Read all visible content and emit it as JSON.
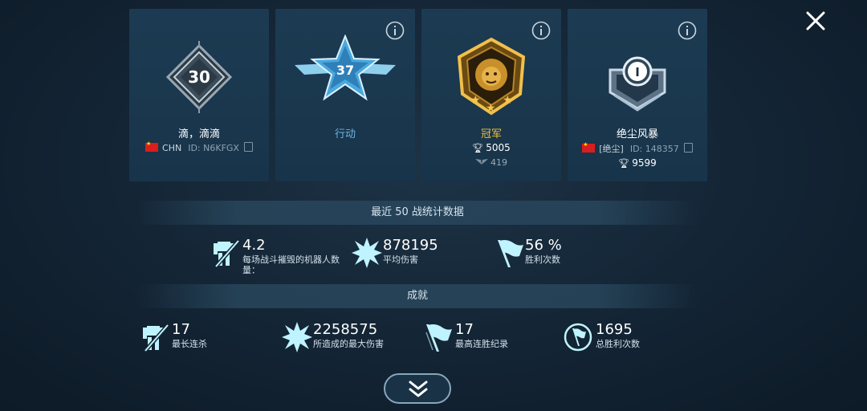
{
  "close_icon": "close-icon",
  "cards": {
    "player": {
      "level": "30",
      "name": "滴，滴滴",
      "country": "CHN",
      "id": "ID: N6KFGX"
    },
    "rank": {
      "level": "37",
      "name": "行动"
    },
    "league": {
      "name": "冠军",
      "trophies": "5005",
      "sub_value": "419"
    },
    "clan": {
      "badge_text": "I",
      "name": "绝尘风暴",
      "tag": "[绝尘]",
      "id": "ID: 148357",
      "trophies": "9599"
    }
  },
  "recent": {
    "title": "最近 50 战统计数据",
    "stats": [
      {
        "value": "4.2",
        "label_line1": "每场战斗摧毁的机器人数",
        "label_line2": "量："
      },
      {
        "value": "878195",
        "label_line1": "平均伤害",
        "label_line2": ""
      },
      {
        "value": "56 %",
        "label_line1": "胜利次数",
        "label_line2": ""
      }
    ]
  },
  "achievements": {
    "title": "成就",
    "stats": [
      {
        "value": "17",
        "label": "最长连杀"
      },
      {
        "value": "2258575",
        "label": "所造成的最大伤害"
      },
      {
        "value": "17",
        "label": "最高连胜纪录"
      },
      {
        "value": "1695",
        "label": "总胜利次数"
      }
    ]
  },
  "colors": {
    "accent": "#6fb3e0",
    "gold": "#f0c040",
    "icon_cyan": "#bff3ff"
  }
}
